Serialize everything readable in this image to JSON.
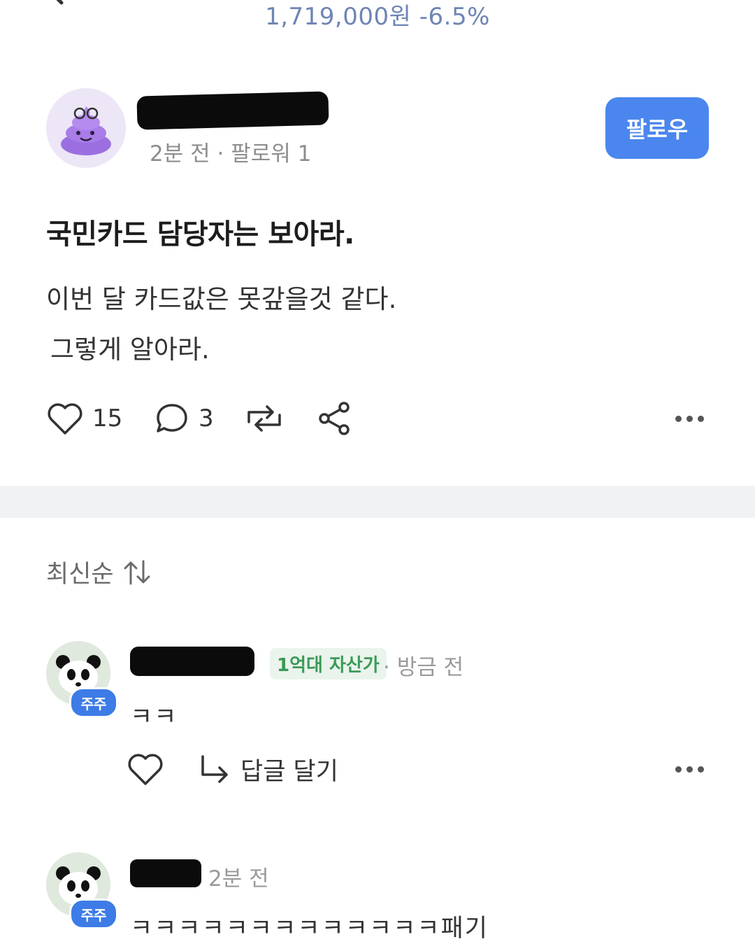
{
  "header": {
    "price": "1,719,000원",
    "change": "-6.5%"
  },
  "post": {
    "meta": "2분 전 · 팔로워 1",
    "follow_label": "팔로우",
    "title": "국민카드 담당자는 보아라.",
    "body_lines": [
      "이번 달 카드값은 못갚을것 같다.",
      "그렇게 알아라."
    ],
    "likes": "15",
    "comments": "3"
  },
  "colors": {
    "accent": "#4a86ee",
    "badge": "#3d7be6",
    "asset_tag_bg": "#eaf4ec",
    "asset_tag_text": "#3b9a57"
  },
  "comments_section": {
    "sort_label": "최신순",
    "items": [
      {
        "badge": "주주",
        "asset_tag": "1억대 자산가",
        "time": "· 방금 전",
        "text": "ㅋㅋ",
        "reply_label": "답글 달기"
      },
      {
        "badge": "주주",
        "time": "2분 전",
        "text": "ㅋㅋㅋㅋㅋㅋㅋㅋㅋㅋㅋㅋㅋ패기"
      }
    ]
  },
  "icons": [
    "back-icon",
    "heart-icon",
    "comment-icon",
    "repost-icon",
    "share-icon",
    "more-icon",
    "sort-icon",
    "reply-arrow-icon"
  ]
}
